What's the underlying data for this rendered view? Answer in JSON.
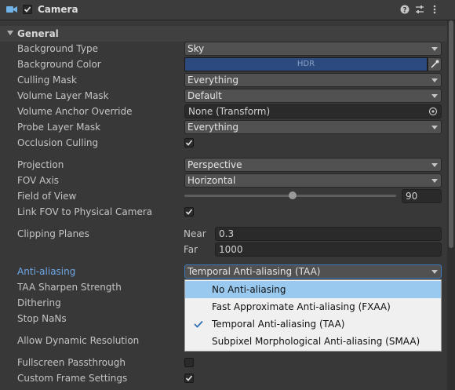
{
  "header": {
    "title": "Camera",
    "enabled": true,
    "icons": [
      "camera-icon",
      "help-icon",
      "preset-icon",
      "more-icon"
    ]
  },
  "section": {
    "title": "General"
  },
  "rows": {
    "background_type": {
      "label": "Background Type",
      "value": "Sky"
    },
    "background_color": {
      "label": "Background Color",
      "value": "HDR",
      "color": "#2c4a7e"
    },
    "culling_mask": {
      "label": "Culling Mask",
      "value": "Everything"
    },
    "volume_layer_mask": {
      "label": "Volume Layer Mask",
      "value": "Default"
    },
    "volume_anchor_override": {
      "label": "Volume Anchor Override",
      "value": "None (Transform)"
    },
    "probe_layer_mask": {
      "label": "Probe Layer Mask",
      "value": "Everything"
    },
    "occlusion_culling": {
      "label": "Occlusion Culling",
      "checked": true
    },
    "projection": {
      "label": "Projection",
      "value": "Perspective"
    },
    "fov_axis": {
      "label": "FOV Axis",
      "value": "Horizontal"
    },
    "field_of_view": {
      "label": "Field of View",
      "value": "90"
    },
    "link_fov": {
      "label": "Link FOV to Physical Camera",
      "checked": true
    },
    "clipping_planes": {
      "label": "Clipping Planes",
      "near_label": "Near",
      "near": "0.3",
      "far_label": "Far",
      "far": "1000"
    },
    "anti_aliasing": {
      "label": "Anti-aliasing",
      "value": "Temporal Anti-aliasing (TAA)"
    },
    "taa_sharpen": {
      "label": "TAA Sharpen Strength"
    },
    "dithering": {
      "label": "Dithering"
    },
    "stop_nans": {
      "label": "Stop NaNs"
    },
    "allow_dynamic_resolution": {
      "label": "Allow Dynamic Resolution"
    },
    "fullscreen_passthrough": {
      "label": "Fullscreen Passthrough",
      "checked": false
    },
    "custom_frame_settings": {
      "label": "Custom Frame Settings",
      "checked": true
    }
  },
  "aa_menu": {
    "items": [
      {
        "label": "No Anti-aliasing",
        "highlighted": true,
        "checked": false
      },
      {
        "label": "Fast Approximate Anti-aliasing (FXAA)",
        "highlighted": false,
        "checked": false
      },
      {
        "label": "Temporal Anti-aliasing (TAA)",
        "highlighted": false,
        "checked": true
      },
      {
        "label": "Subpixel Morphological Anti-aliasing (SMAA)",
        "highlighted": false,
        "checked": false
      }
    ]
  },
  "colors": {
    "accent": "#6fa7e8",
    "menu_highlight": "#99c9ef",
    "panel": "#383838"
  }
}
